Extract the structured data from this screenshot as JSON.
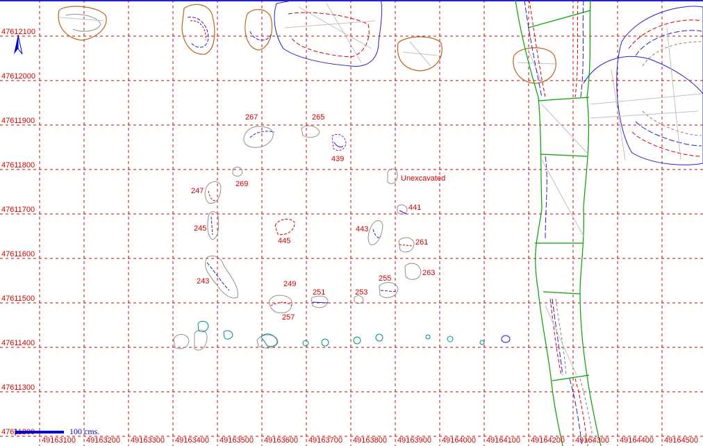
{
  "axes": {
    "x_ticks": [
      "49163100",
      "49163200",
      "49163300",
      "49163400",
      "49163500",
      "49163600",
      "49163700",
      "49163800",
      "49163900",
      "49164000",
      "49164100",
      "49164200",
      "49164300",
      "49164400",
      "49164500"
    ],
    "y_ticks": [
      "47612100",
      "47612000",
      "47611900",
      "47611800",
      "47611700",
      "47611600",
      "47611500",
      "47611400",
      "47611300",
      "47611200"
    ]
  },
  "feature_labels": [
    "267",
    "265",
    "439",
    "Unexcavated",
    "269",
    "247",
    "441",
    "245",
    "445",
    "443",
    "261",
    "263",
    "255",
    "243",
    "249",
    "251",
    "253",
    "257"
  ],
  "scale_bar": {
    "label": "100 cms."
  },
  "colors": {
    "grid": "#d40000",
    "label": "#cc0000",
    "trench": "#00a000",
    "contour_blue": "#2020cc",
    "orange_outline": "#b8651a",
    "teal": "#008c8c",
    "gray": "#909090"
  },
  "icons": [
    "north-arrow-icon"
  ]
}
